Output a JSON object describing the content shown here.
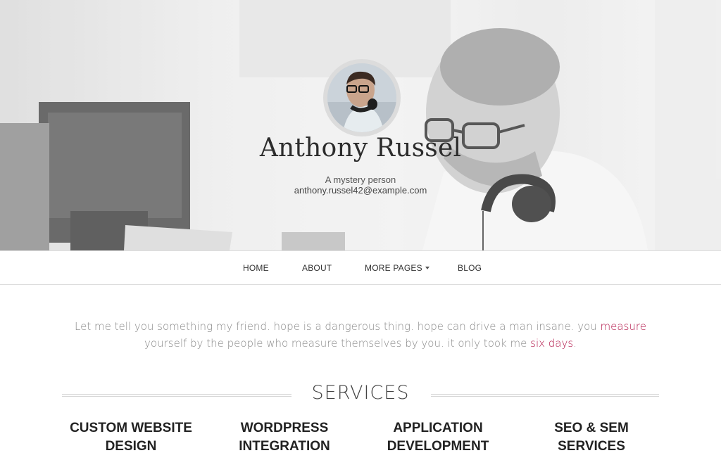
{
  "profile": {
    "name": "Anthony Russel",
    "tagline": "A mystery person",
    "email": "anthony.russel42@example.com"
  },
  "nav": {
    "items": [
      {
        "label": "HOME"
      },
      {
        "label": "ABOUT"
      },
      {
        "label": "MORE PAGES",
        "has_dropdown": true
      },
      {
        "label": "BLOG"
      }
    ]
  },
  "intro": {
    "text_before": "Let me tell you something my friend. hope is a dangerous thing. hope can drive a man insane. you ",
    "link1": "measure",
    "text_middle": " yourself by the people who measure themselves by you. it only took me ",
    "link2": "six days",
    "text_after": "."
  },
  "services": {
    "title": "SERVICES",
    "items": [
      {
        "line1": "CUSTOM WEBSITE",
        "line2": "DESIGN"
      },
      {
        "line1": "WORDPRESS",
        "line2": "INTEGRATION"
      },
      {
        "line1": "APPLICATION",
        "line2": "DEVELOPMENT"
      },
      {
        "line1": "SEO & SEM",
        "line2": "SERVICES"
      }
    ]
  },
  "colors": {
    "accent_link": "#b3174a",
    "text_muted": "#8a8a8a",
    "heading": "#2c2c2c"
  }
}
